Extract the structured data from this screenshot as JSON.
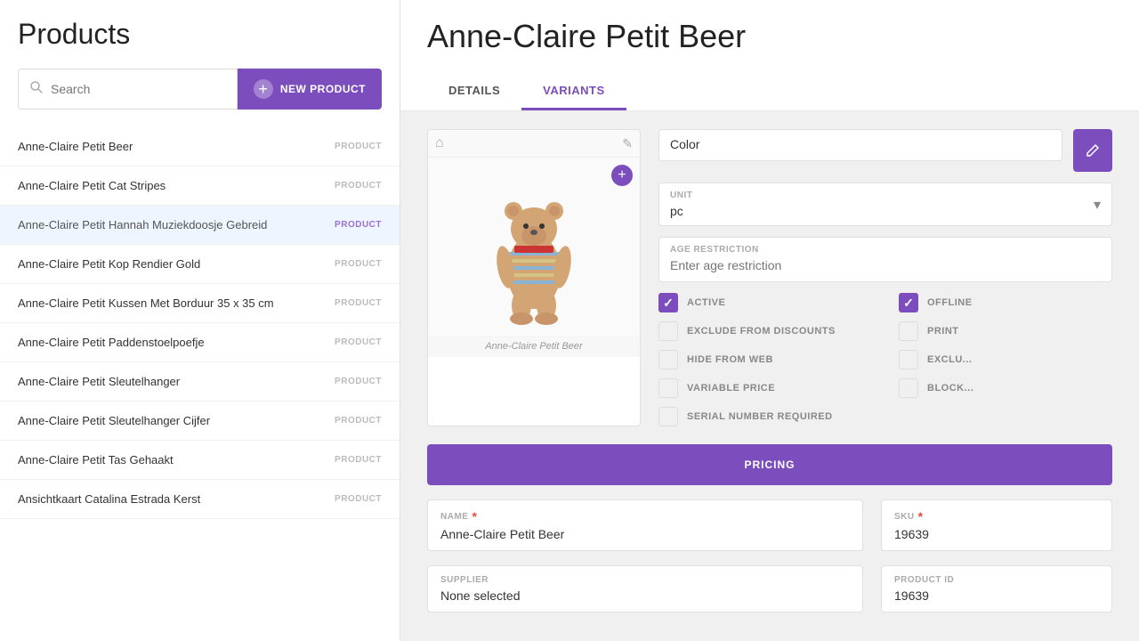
{
  "left": {
    "title": "Products",
    "search": {
      "placeholder": "Search",
      "value": ""
    },
    "new_product_label": "NEW PRODUCT",
    "products": [
      {
        "name": "Anne-Claire Petit Beer",
        "badge": "PRODUCT",
        "active": true
      },
      {
        "name": "Anne-Claire Petit Cat Stripes",
        "badge": "PRODUCT",
        "active": false
      },
      {
        "name": "Anne-Claire Petit Hannah Muziekdoosje Gebreid",
        "badge": "PRODUCT",
        "active": true,
        "selected": true
      },
      {
        "name": "Anne-Claire Petit Kop Rendier Gold",
        "badge": "PRODUCT",
        "active": false
      },
      {
        "name": "Anne-Claire Petit Kussen Met Borduur 35 x 35 cm",
        "badge": "PRODUCT",
        "active": false
      },
      {
        "name": "Anne-Claire Petit Paddenstoelpoefje",
        "badge": "PRODUCT",
        "active": false
      },
      {
        "name": "Anne-Claire Petit Sleutelhanger",
        "badge": "PRODUCT",
        "active": false
      },
      {
        "name": "Anne-Claire Petit Sleutelhanger Cijfer",
        "badge": "PRODUCT",
        "active": false
      },
      {
        "name": "Anne-Claire Petit Tas Gehaakt",
        "badge": "PRODUCT",
        "active": false
      },
      {
        "name": "Ansichtkaart Catalina Estrada Kerst",
        "badge": "PRODUCT",
        "active": false
      }
    ]
  },
  "right": {
    "product_title": "Anne-Claire Petit Beer",
    "tabs": [
      {
        "label": "DETAILS",
        "active": false
      },
      {
        "label": "VARIANTS",
        "active": true
      }
    ],
    "image_caption": "Anne-Claire Petit Beer",
    "color_field_label": "Color",
    "unit_field": {
      "label": "UNIT",
      "value": "pc"
    },
    "age_restriction": {
      "label": "AGE RESTRICTION",
      "placeholder": "Enter age restriction"
    },
    "checkboxes": [
      {
        "label": "ACTIVE",
        "checked": true
      },
      {
        "label": "OFFLINE",
        "checked": true
      },
      {
        "label": "EXCLUDE FROM DISCOUNTS",
        "checked": false
      },
      {
        "label": "PRINT",
        "checked": false
      },
      {
        "label": "HIDE FROM WEB",
        "checked": false
      },
      {
        "label": "EXCLU...",
        "checked": false
      },
      {
        "label": "VARIABLE PRICE",
        "checked": false
      },
      {
        "label": "BLOCK...",
        "checked": false
      },
      {
        "label": "SERIAL NUMBER REQUIRED",
        "checked": false
      }
    ],
    "pricing_label": "PRICING",
    "sku": {
      "label": "SKU",
      "value": "19639"
    },
    "product_id": {
      "label": "PRODUCT ID",
      "value": "19639"
    },
    "name_field": {
      "label": "NAME",
      "value": "Anne-Claire Petit Beer"
    },
    "supplier_field": {
      "label": "SUPPLIER",
      "value": "None selected"
    }
  }
}
